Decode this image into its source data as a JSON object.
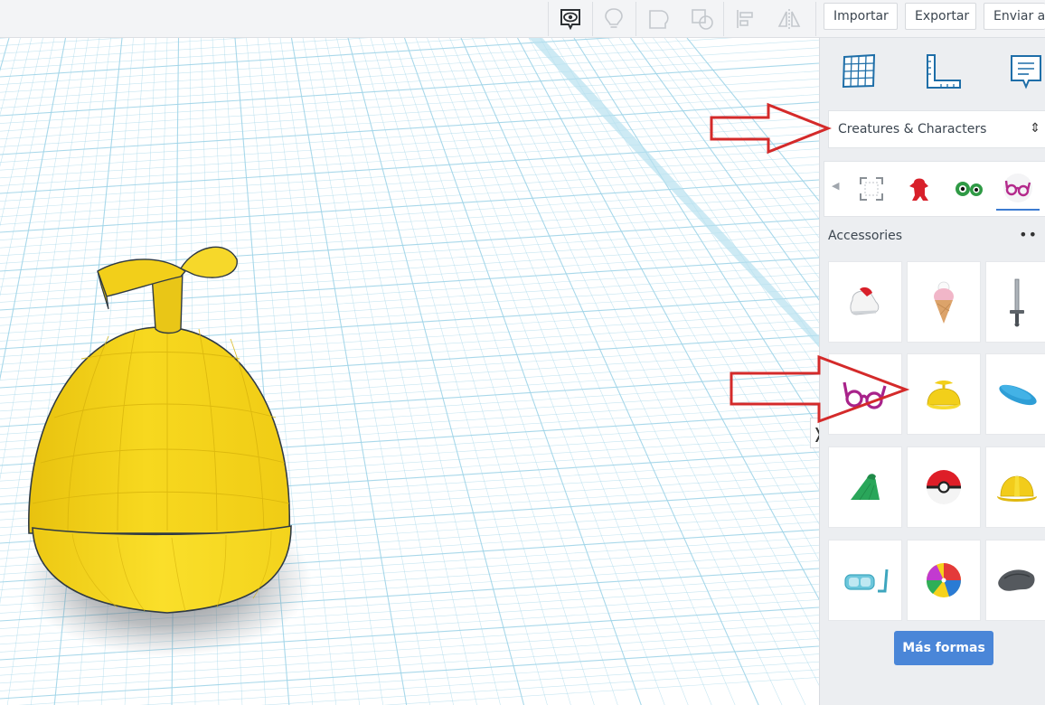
{
  "toolbar": {
    "icons": [
      "eye-icon",
      "lightbulb-icon",
      "group-icon",
      "ungroup-icon",
      "align-icon",
      "mirror-icon"
    ],
    "import_label": "Importar",
    "export_label": "Exportar",
    "send_label": "Enviar a"
  },
  "panel": {
    "view_icons": [
      "grid-icon",
      "ruler-icon",
      "notes-icon"
    ],
    "category_dropdown": "Creatures & Characters",
    "category_dropdown_arrow": "⇕",
    "subcategory_icons": [
      "all-shapes-icon",
      "creature-icon",
      "eyes-icon",
      "glasses-icon"
    ],
    "active_subcategory": "glasses-icon",
    "section_title": "Accessories",
    "more_menu": "••",
    "shapes": [
      "sneaker-shape",
      "ice-cream-shape",
      "sword-shape",
      "glasses-shape",
      "propeller-hat-shape",
      "beret-shape",
      "flipper-shape",
      "pokeball-shape",
      "hard-hat-shape",
      "snorkel-mask-shape",
      "beach-ball-shape",
      "pirate-hat-shape"
    ],
    "more_shapes_label": "Más formas",
    "collapse_glyph": "❭"
  },
  "colors": {
    "accent": "#4a86d8",
    "hat_yellow": "#f6d21c",
    "grid_blue": "#9fd4e8",
    "annotation_red": "#d42a2a"
  }
}
